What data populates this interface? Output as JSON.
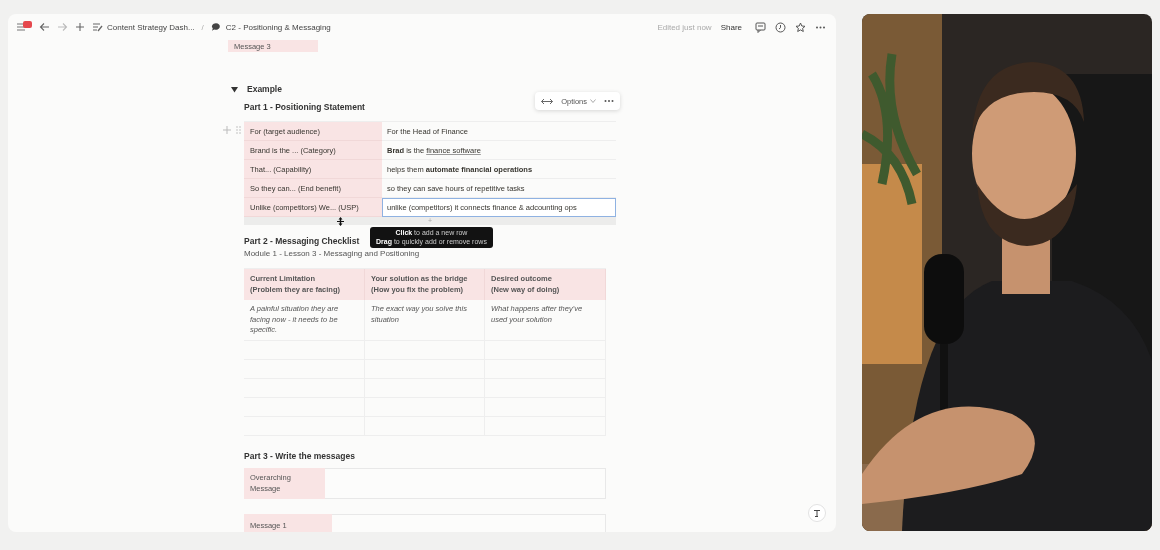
{
  "topbar": {
    "breadcrumbs": [
      {
        "kind": "doc-list",
        "text": "Content Strategy Dash..."
      },
      {
        "kind": "chat",
        "text": "C2 - Positioning & Messaging"
      }
    ],
    "separator": "/",
    "status": "Edited just now",
    "share": "Share"
  },
  "doc": {
    "cut_cell": "Message 3",
    "toggle": {
      "label": "Example",
      "expanded": true
    },
    "part1": {
      "heading": "Part 1 - Positioning Statement",
      "options": "Options",
      "rows": [
        {
          "label": "For (target audience)",
          "value": "For the Head of Finance",
          "focused": false
        },
        {
          "label": "Brand is the ... (Category)",
          "value": "**Brad** is the",
          "link": "finance software",
          "focused": false
        },
        {
          "label": "That... (Capability)",
          "value": "helps them **automate financial operations**",
          "focused": false
        },
        {
          "label": "So they can... (End benefit)",
          "value": "so they can save hours of repetitive tasks",
          "focused": false
        },
        {
          "label": "Unlike (competitors) We... (USP)",
          "value": "unlike (competitors) it connects finance & adcounting ops",
          "focused": true
        }
      ],
      "add_row": "+",
      "tooltip": [
        "**Click** to add a new row",
        "**Drag** to quickly add or remove rows"
      ]
    },
    "part2": {
      "heading": "Part 2 - Messaging Checklist",
      "subheading": "Module 1 - Lesson 3 - Messaging and Positioning",
      "columns": [
        "Current Limitation\n(Problem they are facing)",
        "Your solution as the bridge\n(How you fix the problem)",
        "Desired outcome\n(New way of doing)"
      ],
      "rows": [
        {
          "kind": "text",
          "cells": [
            "A painful situation they are facing now - it needs to be specific.",
            "The exact way you solve this situation",
            "What happens after they've used your solution"
          ]
        },
        {
          "kind": "blank"
        },
        {
          "kind": "blank"
        },
        {
          "kind": "blank"
        },
        {
          "kind": "blank"
        },
        {
          "kind": "blank"
        }
      ]
    },
    "part3": {
      "heading": "Part 3 - Write the messages",
      "messages": [
        {
          "label": "Overarching Message",
          "kind": "wide"
        },
        {
          "label": "Message 1",
          "kind": "narrow"
        }
      ]
    }
  }
}
